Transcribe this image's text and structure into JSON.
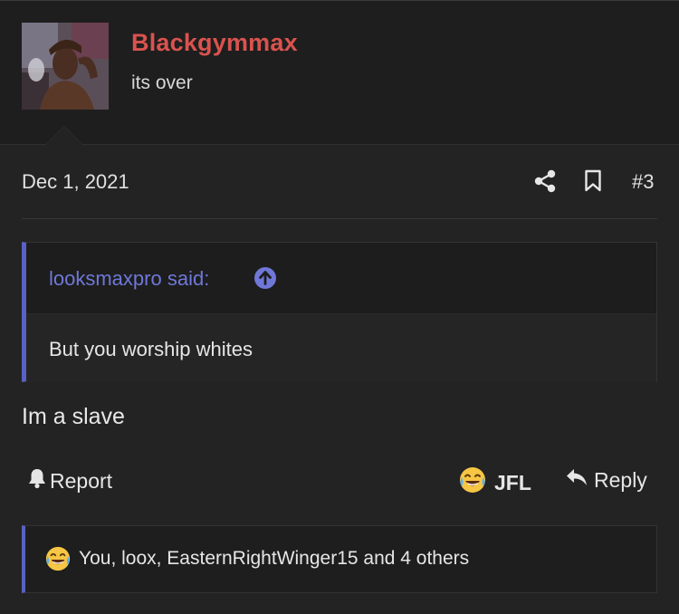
{
  "user": {
    "name": "Blackgymmax",
    "title": "its over"
  },
  "post": {
    "date": "Dec 1, 2021",
    "number": "#3",
    "message": "Im a slave"
  },
  "quote": {
    "author": "looksmaxpro said:",
    "text": "But you worship whites"
  },
  "actions": {
    "report": "Report",
    "reaction": "JFL",
    "reply": "Reply"
  },
  "reactions": {
    "summary": "You, loox, EasternRightWinger15 and 4 others"
  },
  "icons": {
    "share": "share-icon",
    "bookmark": "bookmark-icon",
    "quote_jump": "arrow-up-circle-icon",
    "report": "bell-icon",
    "reaction": "laughing-crying-emoji-icon",
    "reply": "reply-arrow-icon"
  },
  "colors": {
    "username": "#d9534f",
    "accent": "#5961c4",
    "quote_author": "#6f78d8",
    "background": "#232323"
  }
}
